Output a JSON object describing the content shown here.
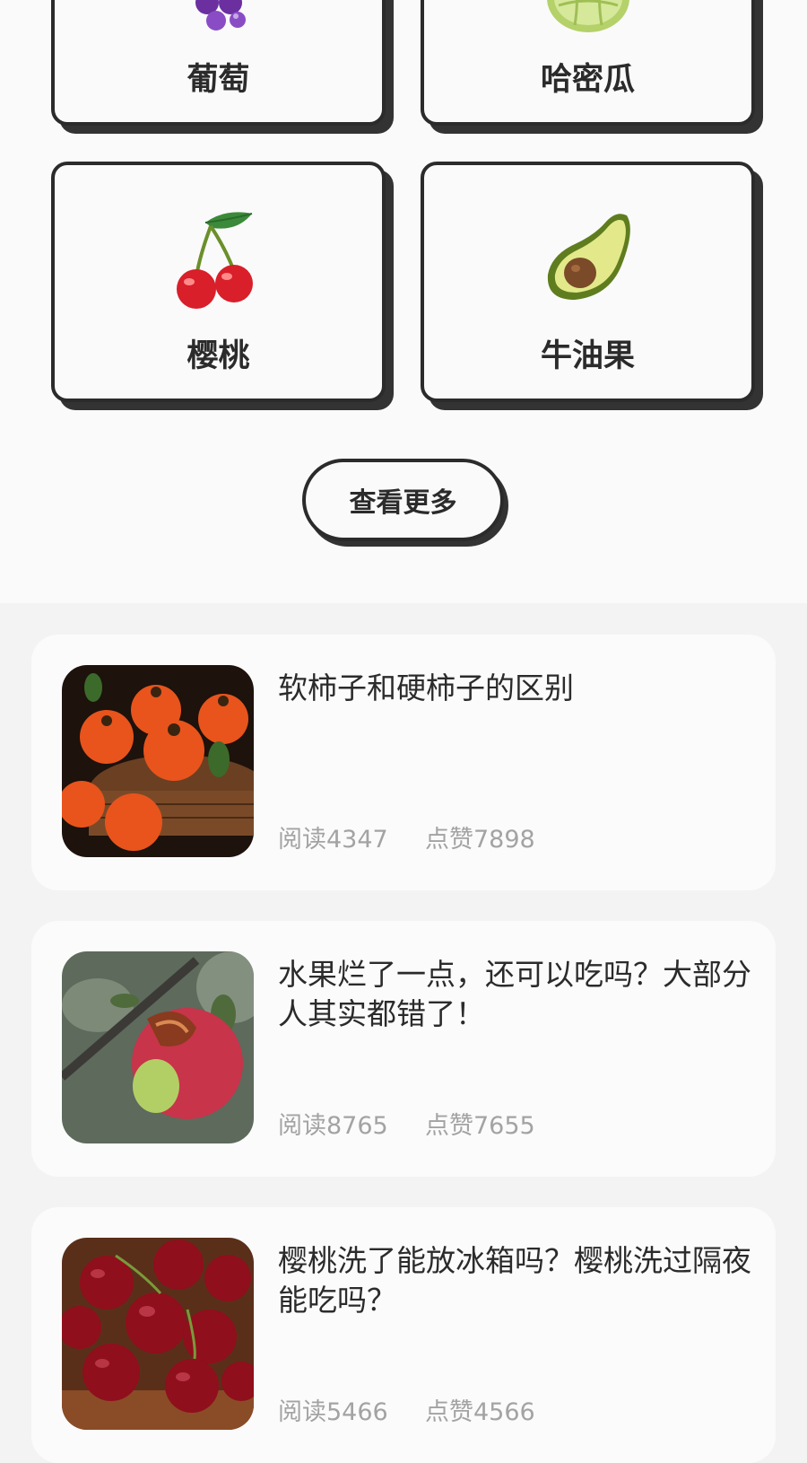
{
  "categories": [
    {
      "label": "葡萄",
      "icon": "grape-icon"
    },
    {
      "label": "哈密瓜",
      "icon": "melon-icon"
    },
    {
      "label": "樱桃",
      "icon": "cherry-icon"
    },
    {
      "label": "牛油果",
      "icon": "avocado-icon"
    }
  ],
  "more_button_label": "查看更多",
  "articles": [
    {
      "title": "软柿子和硬柿子的区别",
      "read": "阅读4347",
      "likes": "点赞7898",
      "image": "persimmon-basket-image"
    },
    {
      "title": "水果烂了一点，还可以吃吗？大部分人其实都错了！",
      "read": "阅读8765",
      "likes": "点赞7655",
      "image": "rotten-apple-image"
    },
    {
      "title": "樱桃洗了能放冰箱吗？樱桃洗过隔夜能吃吗？",
      "read": "阅读5466",
      "likes": "点赞4566",
      "image": "cherries-image"
    }
  ],
  "colors": {
    "card_border": "#2b2b2b",
    "page_bg": "#fafafa",
    "list_bg": "#f3f3f3",
    "stat_text": "#a3a3a3"
  }
}
